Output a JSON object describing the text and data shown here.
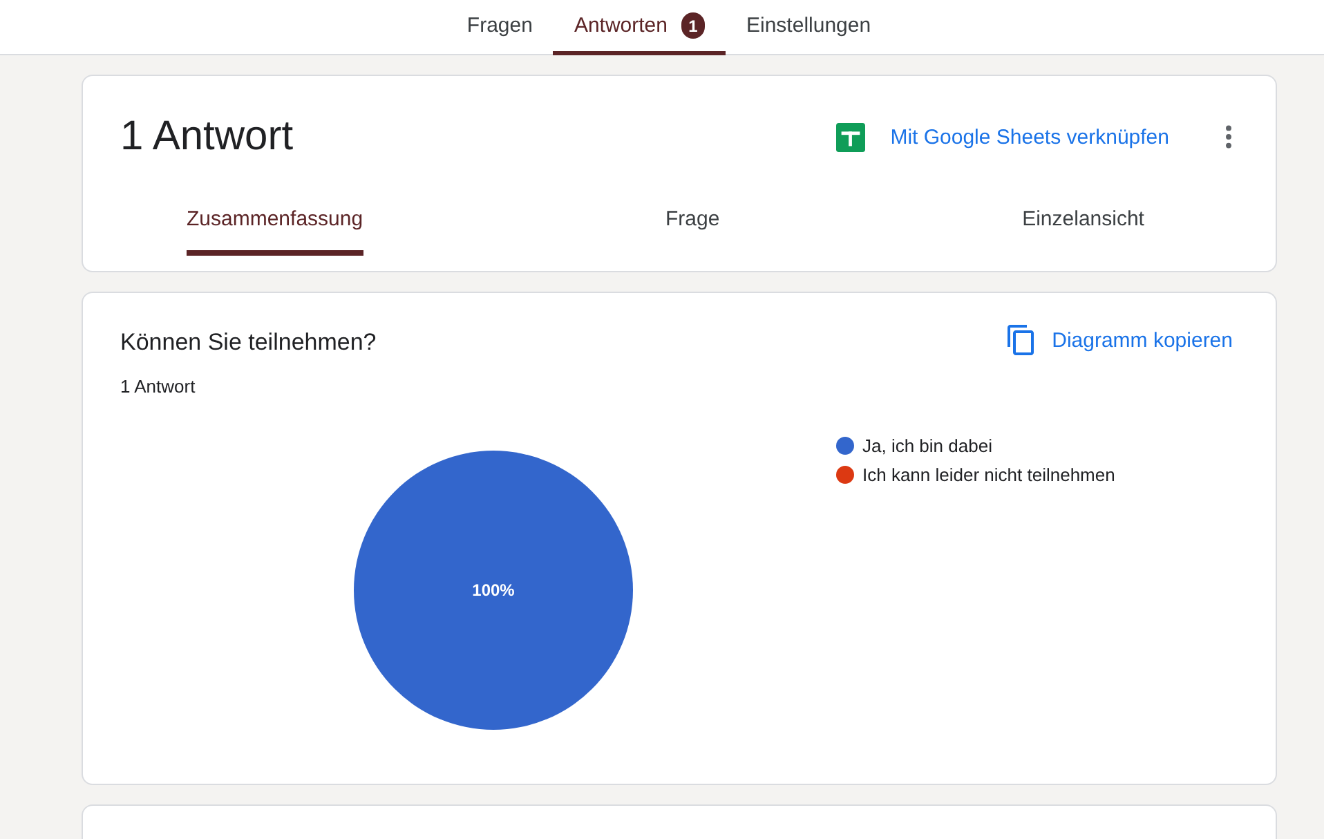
{
  "top_tabs": [
    {
      "label": "Fragen",
      "selected": false
    },
    {
      "label": "Antworten",
      "selected": true,
      "badge": "1"
    },
    {
      "label": "Einstellungen",
      "selected": false
    }
  ],
  "summary": {
    "title": "1 Antwort",
    "link": "Mit Google Sheets verknüpfen",
    "view_tabs": [
      {
        "label": "Zusammenfassung",
        "selected": true
      },
      {
        "label": "Frage",
        "selected": false
      },
      {
        "label": "Einzelansicht",
        "selected": false
      }
    ]
  },
  "question": {
    "title": "Können Sie teilnehmen?",
    "count": "1 Antwort",
    "copy": "Diagramm kopieren",
    "chart_data": {
      "type": "pie",
      "categories": [
        "Ja, ich bin dabei",
        "Ich kann leider nicht teilnehmen"
      ],
      "values": [
        1,
        0
      ],
      "colors": [
        "#3366cc",
        "#dc3912"
      ],
      "value_labels": [
        "100%",
        null
      ]
    }
  }
}
